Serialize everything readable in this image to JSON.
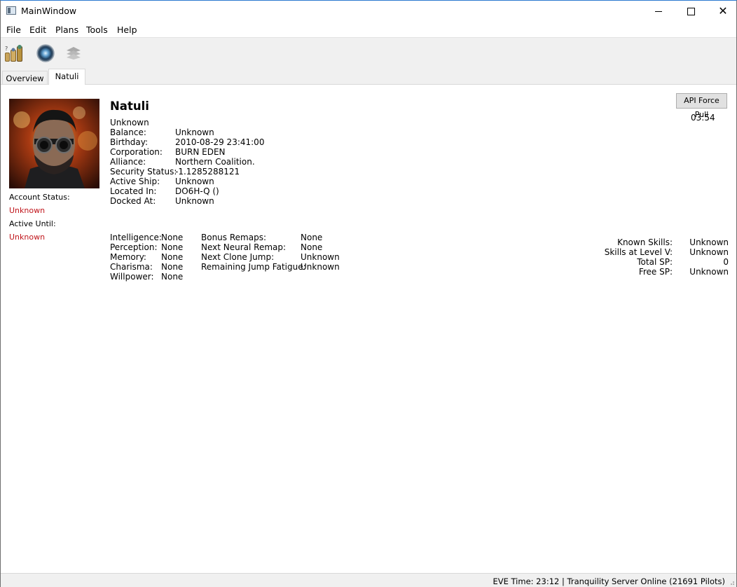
{
  "window": {
    "title": "MainWindow"
  },
  "menu": [
    "File",
    "Edit",
    "Plans",
    "Tools",
    "Help"
  ],
  "toolbar": {
    "icons": [
      "skills-icon",
      "orb-icon",
      "layers-icon"
    ]
  },
  "tabs": [
    "Overview",
    "Natuli"
  ],
  "character": {
    "name": "Natuli",
    "subtitle": "Unknown",
    "info": [
      {
        "label": "Balance:",
        "value": "Unknown"
      },
      {
        "label": "Birthday:",
        "value": "2010-08-29 23:41:00"
      },
      {
        "label": "Corporation:",
        "value": "BURN EDEN"
      },
      {
        "label": "Alliance:",
        "value": "Northern Coalition."
      },
      {
        "label": "Security Status:",
        "value": "-1.1285288121"
      },
      {
        "label": "Active Ship:",
        "value": "Unknown"
      },
      {
        "label": "Located In:",
        "value": "DO6H-Q ()"
      },
      {
        "label": "Docked At:",
        "value": "Unknown"
      }
    ],
    "account_status_label": "Account Status:",
    "account_status_value": "Unknown",
    "active_until_label": "Active Until:",
    "active_until_value": "Unknown",
    "attributes": [
      {
        "label": "Intelligence:",
        "value": "None"
      },
      {
        "label": "Perception:",
        "value": "None"
      },
      {
        "label": "Memory:",
        "value": "None"
      },
      {
        "label": "Charisma:",
        "value": "None"
      },
      {
        "label": "Willpower:",
        "value": "None"
      }
    ],
    "remaps": [
      {
        "label": "Bonus Remaps:",
        "value": "None"
      },
      {
        "label": "Next Neural Remap:",
        "value": "None"
      },
      {
        "label": "Next Clone Jump:",
        "value": "Unknown"
      },
      {
        "label": "Remaining Jump Fatigue:",
        "value": "Unknown"
      }
    ],
    "skills": [
      {
        "label": "Known Skills:",
        "value": "Unknown"
      },
      {
        "label": "Skills at Level V:",
        "value": "Unknown"
      },
      {
        "label": "Total SP:",
        "value": "0"
      },
      {
        "label": "Free SP:",
        "value": "Unknown"
      }
    ]
  },
  "api": {
    "button_label": "API Force Pull",
    "timer": "03:54"
  },
  "status": {
    "text": "EVE Time: 23:12 | Tranquility Server Online (21691 Pilots)"
  },
  "colors": {
    "status_red": "#c0151b",
    "chrome": "#f0f0f0"
  }
}
